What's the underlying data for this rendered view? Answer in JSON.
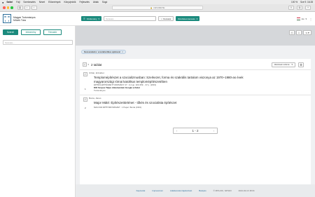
{
  "menubar": {
    "app": "Safari",
    "items": [
      "Fájl",
      "Szerkesztés",
      "Nézet",
      "Előzmények",
      "Könyvjelzők",
      "Fejlesztés",
      "Ablak",
      "Súgó"
    ],
    "status": [
      "100 %",
      "Sze 9. 16:28"
    ]
  },
  "browser": {
    "url": "m2.mtmt.hu",
    "colors": {
      "close": "#ff5f57",
      "min": "#ffbd2e",
      "max": "#28c840"
    }
  },
  "header": {
    "logo_letters": [
      "m",
      "m",
      "t",
      "t"
    ],
    "org_line1": "Magyar Tudományos",
    "org_line2": "Művek Tára",
    "scope_select": "Közlemény",
    "search_placeholder": "Keresés...",
    "search_button": "Keresés",
    "advanced_button": "Részletes keresés",
    "language": "Hu",
    "accent_color": "#1b8a7d"
  },
  "sidebar": {
    "types": [
      "Szerző",
      "Intézmény",
      "Témakör"
    ],
    "active_type": "Szerző",
    "filter_placeholder": "Keresés..."
  },
  "toolbar": {
    "print_icon": "print-icon",
    "export_icon": "export-icon",
    "share_icon": "share-icon"
  },
  "active_filter": {
    "label": "Kereséskulcs: szocialisztikus építészet",
    "remove": "×"
  },
  "results": {
    "count_text": "2 találat",
    "sort_label": "Idézések száma",
    "items": [
      {
        "num": "1",
        "author": "Urbán, Erzsébet",
        "title_line1": "Templomépítészet a szocializmusban: Szerkezet, forma és szakrális tartalom viszonya az 1970–1980-as évek",
        "title_line2": "magyarországi római katolikus templomépítészetében",
        "meta1": "ÉPÍTÉS-ÉPÍTÉSZETTUDOMÁNY 47 : 3-4 pp. 323-359. , 37 p. (2019)",
        "meta2": "DOI Scopus Teljes dokumentum Google scholar",
        "meta3": "Tudományos"
      },
      {
        "num": "2",
        "author": "Bonta, János",
        "title_line1": "Major Máté: Építészettörténet - tőkés és szocialista építészet",
        "meta1": "MAGYAR ÉPÍTŐMŰVÉSZET : 1 Paper: Bonta (1961)"
      }
    ]
  },
  "pagination": {
    "range": "1 - 2",
    "prev": "‹",
    "next": "›"
  },
  "footer": {
    "links": [
      "Kapcsolat",
      "Impresszum",
      "Adatkezelési tájékoztató",
      "Belépés"
    ],
    "copyright": "© MTA-KIK, SZTAKI",
    "date": "2021-02-13 18:04"
  }
}
